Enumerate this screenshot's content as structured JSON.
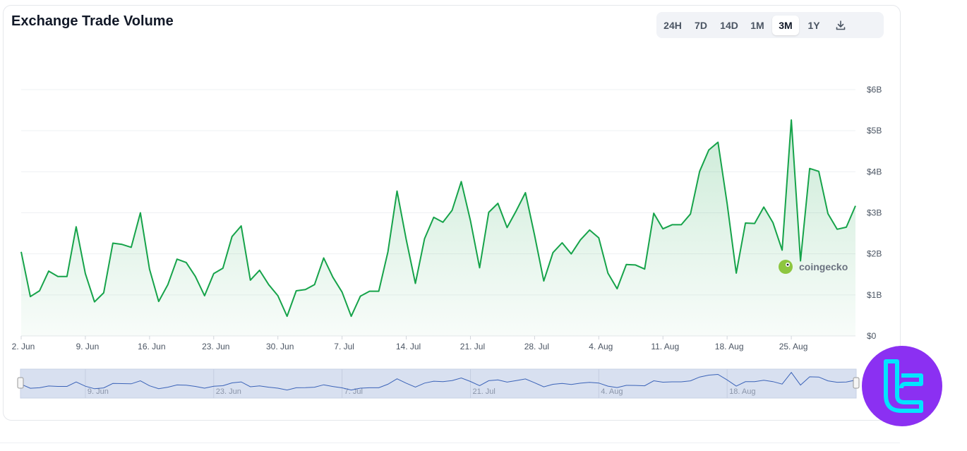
{
  "header": {
    "title": "Exchange Trade Volume"
  },
  "range_selector": {
    "options": [
      "24H",
      "7D",
      "14D",
      "1M",
      "3M",
      "1Y"
    ],
    "selected": "3M",
    "download_icon": "download-icon"
  },
  "watermark": {
    "text": "coingecko",
    "icon": "gecko-logo-icon"
  },
  "colors": {
    "line": "#16a34a",
    "fill": "#dcfce7",
    "navigator_bg": "#d6dff0",
    "navigator_line": "#3b63b8",
    "badge": "#8b30f2",
    "badge_mark": "#00e5ff"
  },
  "chart_data": {
    "type": "area",
    "title": "Exchange Trade Volume",
    "y_ticks": [
      "$0",
      "$1B",
      "$2B",
      "$3B",
      "$4B",
      "$5B",
      "$6B"
    ],
    "ylim": [
      0,
      6
    ],
    "x_ticks": [
      "2. Jun",
      "9. Jun",
      "16. Jun",
      "23. Jun",
      "30. Jun",
      "7. Jul",
      "14. Jul",
      "21. Jul",
      "28. Jul",
      "4. Aug",
      "11. Aug",
      "18. Aug",
      "25. Aug"
    ],
    "navigator_ticks": [
      "9. Jun",
      "23. Jun",
      "7. Jul",
      "21. Jul",
      "4. Aug",
      "18. Aug"
    ],
    "grid": true,
    "x_start": "2025-06-02",
    "y_unit": "USD billions",
    "values": [
      2.05,
      0.96,
      1.1,
      1.58,
      1.45,
      1.45,
      2.66,
      1.52,
      0.83,
      1.05,
      2.26,
      2.23,
      2.16,
      3.0,
      1.63,
      0.84,
      1.25,
      1.87,
      1.79,
      1.45,
      0.98,
      1.52,
      1.65,
      2.42,
      2.68,
      1.36,
      1.6,
      1.25,
      0.98,
      0.48,
      1.1,
      1.13,
      1.25,
      1.9,
      1.43,
      1.07,
      0.48,
      0.97,
      1.09,
      1.09,
      2.05,
      3.53,
      2.35,
      1.28,
      2.37,
      2.89,
      2.77,
      3.06,
      3.76,
      2.81,
      1.66,
      3.01,
      3.23,
      2.64,
      3.05,
      3.49,
      2.45,
      1.34,
      2.03,
      2.27,
      2.0,
      2.34,
      2.58,
      2.39,
      1.53,
      1.15,
      1.74,
      1.73,
      1.63,
      2.99,
      2.61,
      2.71,
      2.71,
      2.97,
      4.01,
      4.53,
      4.72,
      3.22,
      1.53,
      2.75,
      2.74,
      3.14,
      2.76,
      2.09,
      5.26,
      1.83,
      4.08,
      4.01,
      2.98,
      2.6,
      2.65,
      3.17
    ]
  }
}
